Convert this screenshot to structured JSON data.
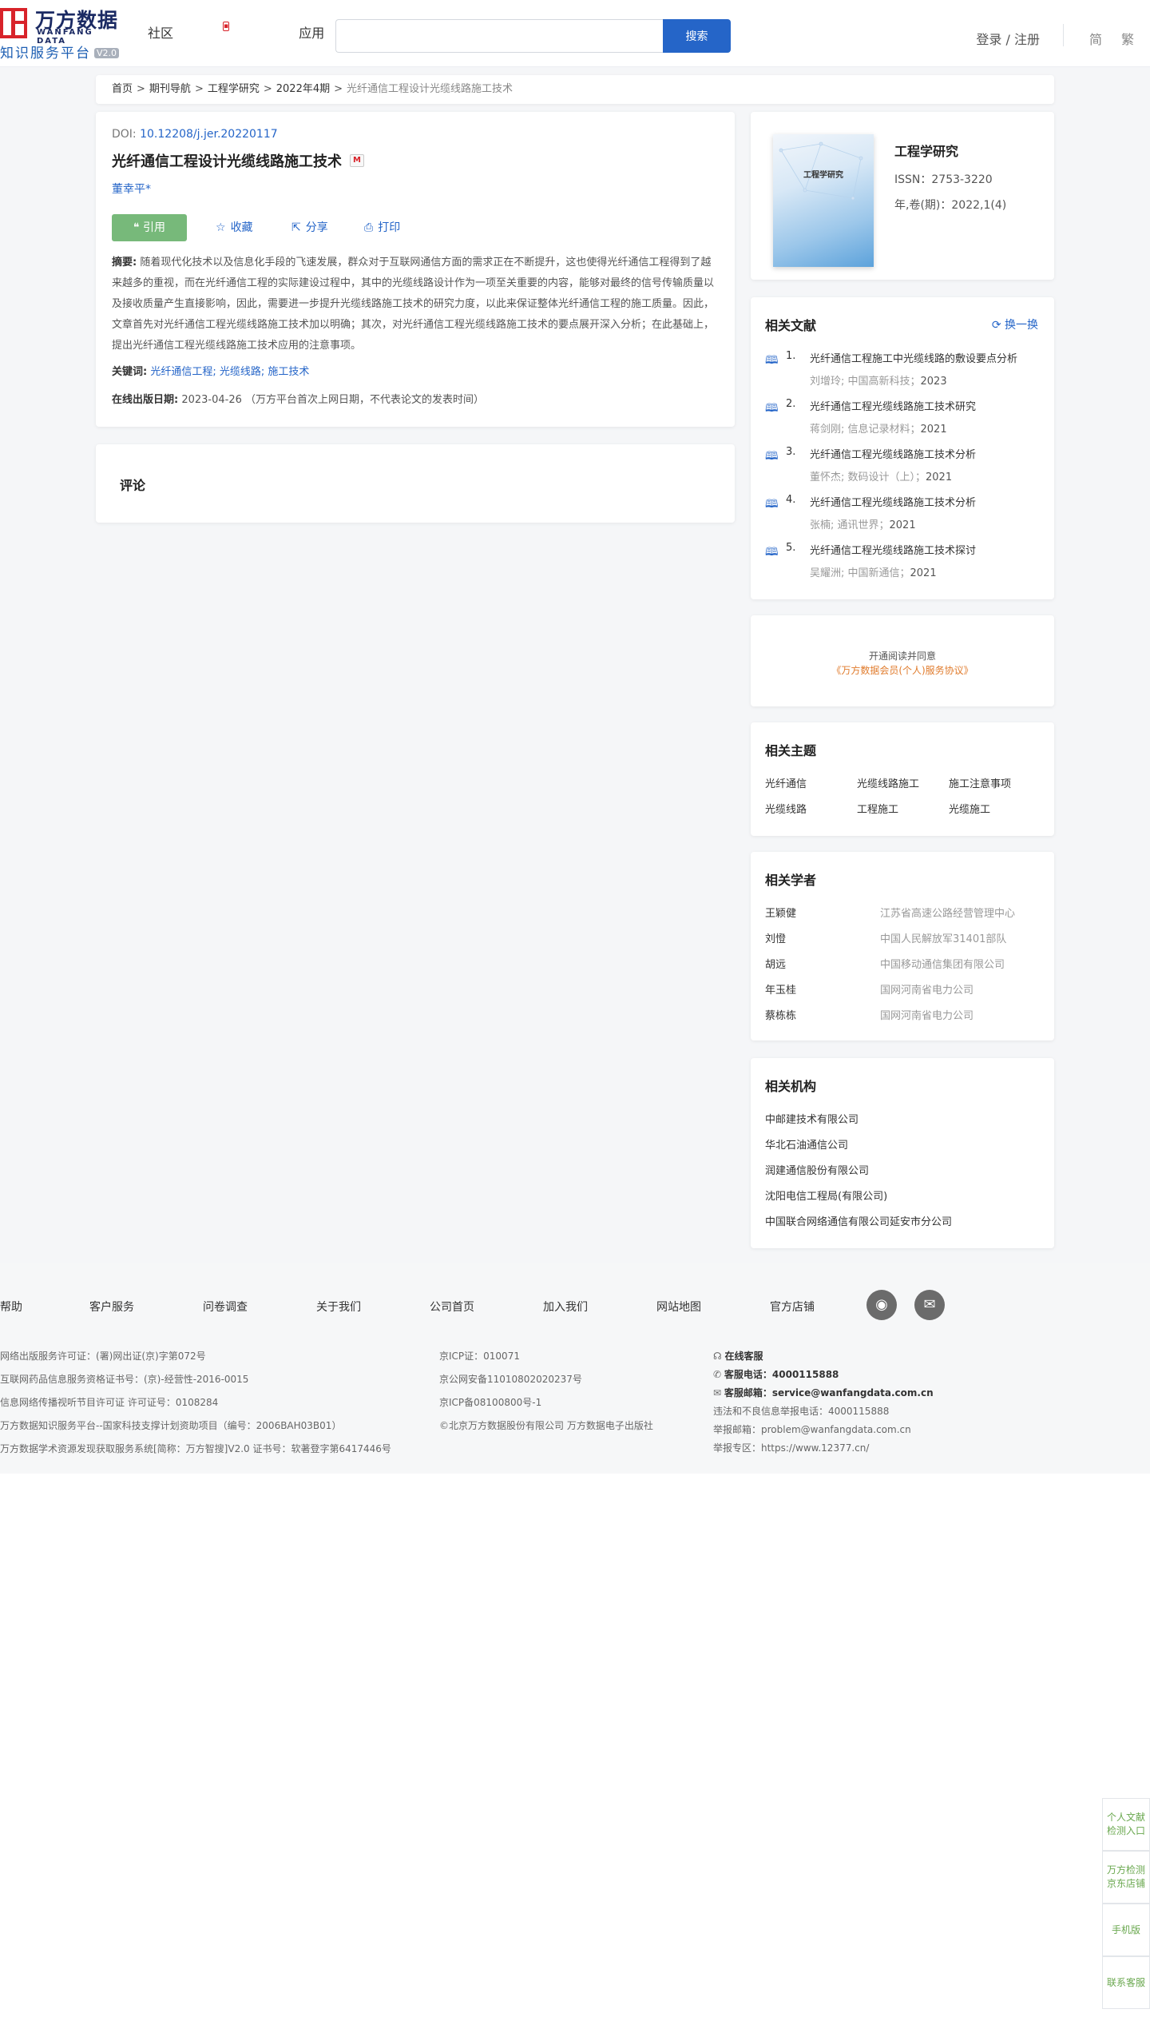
{
  "header": {
    "logo_cn": "万方数据",
    "logo_en": "WANFANG DATA",
    "logo_sub": "知识服务平台",
    "logo_version": "V2.0",
    "nav": [
      {
        "label": "社区"
      },
      {
        "label": "应用"
      }
    ],
    "search_placeholder": "",
    "search_button": "搜索",
    "login": "登录 / 注册",
    "lang_simplified": "简",
    "lang_traditional": "繁"
  },
  "breadcrumb": {
    "items": [
      "首页",
      "期刊导航",
      "工程学研究",
      "2022年4期"
    ],
    "current": "光纤通信工程设计光缆线路施工技术",
    "separator": ">"
  },
  "article": {
    "doi_label": "DOI:",
    "doi": "10.12208/j.jer.20220117",
    "title": "光纤通信工程设计光缆线路施工技术",
    "author": "董幸平*",
    "actions": {
      "cite": "引用",
      "favorite": "收藏",
      "share": "分享",
      "print": "打印"
    },
    "abstract_label": "摘要:",
    "abstract": "随着现代化技术以及信息化手段的飞速发展，群众对于互联网通信方面的需求正在不断提升，这也使得光纤通信工程得到了越来越多的重视，而在光纤通信工程的实际建设过程中，其中的光缆线路设计作为一项至关重要的内容，能够对最终的信号传输质量以及接收质量产生直接影响，因此，需要进一步提升光缆线路施工技术的研究力度，以此来保证整体光纤通信工程的施工质量。因此，文章首先对光纤通信工程光缆线路施工技术加以明确；其次，对光纤通信工程光缆线路施工技术的要点展开深入分析；在此基础上，提出光纤通信工程光缆线路施工技术应用的注意事项。",
    "keywords_label": "关键词:",
    "keywords": [
      "光纤通信工程;",
      "光缆线路;",
      "施工技术"
    ],
    "pubdate_label": "在线出版日期:",
    "pubdate": "2023-04-26",
    "pubdate_note": "（万方平台首次上网日期，不代表论文的发表时间）"
  },
  "comment": {
    "title": "评论"
  },
  "journal": {
    "cover_title": "工程学研究",
    "name": "工程学研究",
    "issn": "ISSN：2753-3220",
    "year": "年,卷(期)：2022,1(4)"
  },
  "related_docs": {
    "title": "相关文献",
    "refresh": "换一换",
    "items": [
      {
        "num": "1.",
        "title": "光纤通信工程施工中光缆线路的敷设要点分析",
        "meta": "刘增玲; 中国高新科技；",
        "year": "2023"
      },
      {
        "num": "2.",
        "title": "光纤通信工程光缆线路施工技术研究",
        "meta": "蒋剑刚; 信息记录材料；",
        "year": "2021"
      },
      {
        "num": "3.",
        "title": "光纤通信工程光缆线路施工技术分析",
        "meta": "董怀杰; 数码设计（上）；",
        "year": "2021"
      },
      {
        "num": "4.",
        "title": "光纤通信工程光缆线路施工技术分析",
        "meta": "张楠; 通讯世界；",
        "year": "2021"
      },
      {
        "num": "5.",
        "title": "光纤通信工程光缆线路施工技术探讨",
        "meta": "吴耀洲; 中国新通信；",
        "year": "2021"
      }
    ]
  },
  "agreement": {
    "line1": "开通阅读并同意",
    "line2": "《万方数据会员(个人)服务协议》"
  },
  "topics": {
    "title": "相关主题",
    "items": [
      "光纤通信",
      "光缆线路施工",
      "施工注意事项",
      "光缆线路",
      "工程施工",
      "光缆施工"
    ]
  },
  "scholars": {
    "title": "相关学者",
    "items": [
      {
        "name": "王颖健",
        "org": "江苏省高速公路经营管理中心"
      },
      {
        "name": "刘憕",
        "org": "中国人民解放军31401部队"
      },
      {
        "name": "胡远",
        "org": "中国移动通信集团有限公司"
      },
      {
        "name": "年玉桂",
        "org": "国网河南省电力公司"
      },
      {
        "name": "蔡栋栋",
        "org": "国网河南省电力公司"
      }
    ]
  },
  "institutions": {
    "title": "相关机构",
    "items": [
      "中邮建技术有限公司",
      "华北石油通信公司",
      "润建通信股份有限公司",
      "沈阳电信工程局(有限公司)",
      "中国联合网络通信有限公司延安市分公司"
    ]
  },
  "footer": {
    "nav": [
      "帮助",
      "客户服务",
      "问卷调查",
      "关于我们",
      "公司首页",
      "加入我们",
      "网站地图",
      "官方店铺"
    ],
    "col1": [
      "网络出版服务许可证：(署)网出证(京)字第072号",
      "互联网药品信息服务资格证书号：(京)-经营性-2016-0015",
      "信息网络传播视听节目许可证 许可证号：0108284",
      "万方数据知识服务平台--国家科技支撑计划资助项目（编号：2006BAH03B01）",
      "万方数据学术资源发现获取服务系统[简称：万方智搜]V2.0 证书号：软著登字第6417446号"
    ],
    "col2": [
      "京ICP证：010071",
      "京公网安备11010802020237号",
      "京ICP备08100800号-1",
      "©北京万方数据股份有限公司 万方数据电子出版社"
    ],
    "online_service": "在线客服",
    "phone_label": "客服电话：",
    "phone": "4000115888",
    "email_label": "客服邮箱：",
    "email": "service@wanfangdata.com.cn",
    "report_phone": "违法和不良信息举报电话：4000115888",
    "report_email": "举报邮箱：problem@wanfangdata.com.cn",
    "report_site": "举报专区：https://www.12377.cn/"
  },
  "side_panel": [
    "个人文献检测入口",
    "万方检测京东店铺",
    "手机版",
    "联系客服"
  ]
}
